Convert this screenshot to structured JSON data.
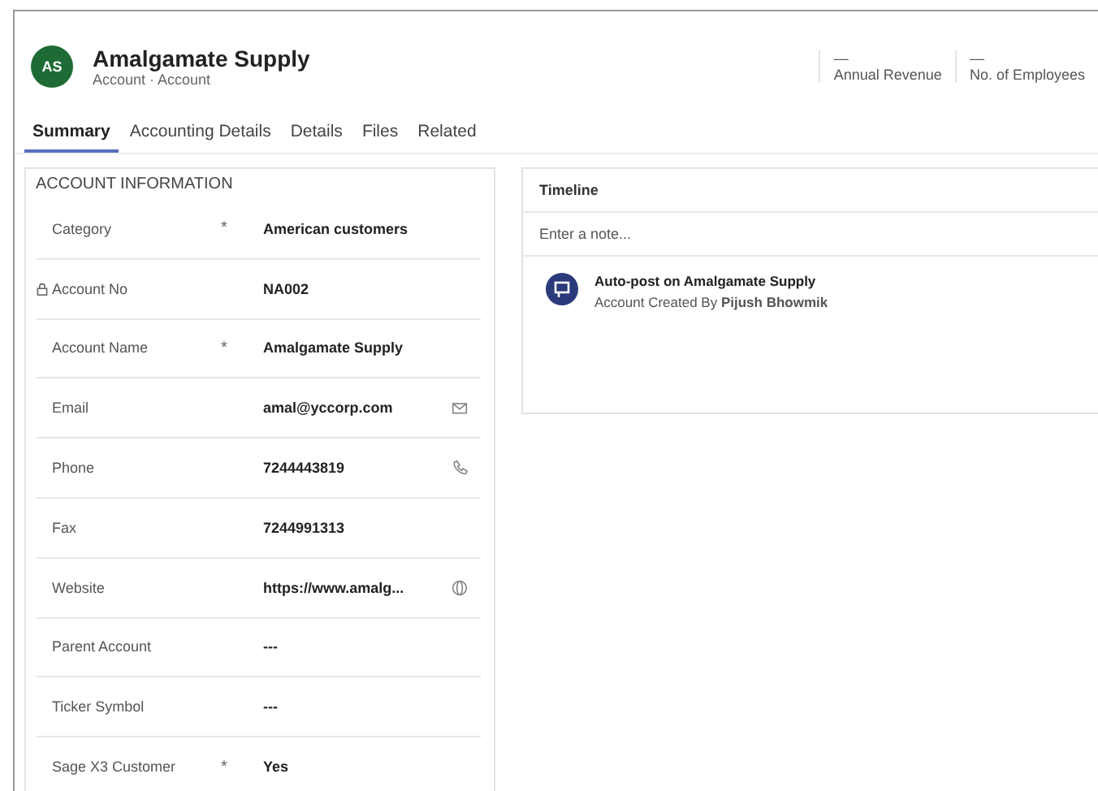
{
  "header": {
    "avatar": "AS",
    "title": "Amalgamate Supply",
    "subtitle": "Account · Account",
    "metrics": [
      {
        "value": "—",
        "label": "Annual Revenue"
      },
      {
        "value": "—",
        "label": "No. of Employees"
      }
    ]
  },
  "tabs": [
    {
      "label": "Summary",
      "selected": true
    },
    {
      "label": "Accounting Details",
      "selected": false
    },
    {
      "label": "Details",
      "selected": false
    },
    {
      "label": "Files",
      "selected": false
    },
    {
      "label": "Related",
      "selected": false
    }
  ],
  "section": {
    "title": "ACCOUNT INFORMATION",
    "fields": [
      {
        "label": "Category",
        "required_mark": "*",
        "locked": false,
        "value": "American customers",
        "kind": "plain"
      },
      {
        "label": "Account No",
        "locked": true,
        "value": "NA002",
        "kind": "plain"
      },
      {
        "label": "Account Name",
        "required_mark": "*",
        "locked": false,
        "value": "Amalgamate Supply",
        "kind": "plain"
      },
      {
        "label": "Email",
        "locked": false,
        "value": "amal@yccorp.com",
        "kind": "email"
      },
      {
        "label": "Phone",
        "locked": false,
        "value": "7244443819",
        "kind": "phone"
      },
      {
        "label": "Fax",
        "locked": false,
        "value": "7244991313",
        "kind": "plain"
      },
      {
        "label": "Website",
        "locked": false,
        "value": "https://www.amalg...",
        "kind": "url"
      },
      {
        "label": "Parent Account",
        "locked": false,
        "value": "---",
        "kind": "plain"
      },
      {
        "label": "Ticker Symbol",
        "locked": false,
        "value": "---",
        "kind": "plain"
      },
      {
        "label": "Sage X3 Customer",
        "required_mark": "*",
        "locked": false,
        "value": "Yes",
        "kind": "plain"
      }
    ]
  },
  "timeline": {
    "title": "Timeline",
    "placeholder": "Enter a note...",
    "posts": [
      {
        "title": "Auto-post on Amalgamate Supply",
        "text": "Account Created By **Pijush Bhowmik**"
      }
    ]
  }
}
